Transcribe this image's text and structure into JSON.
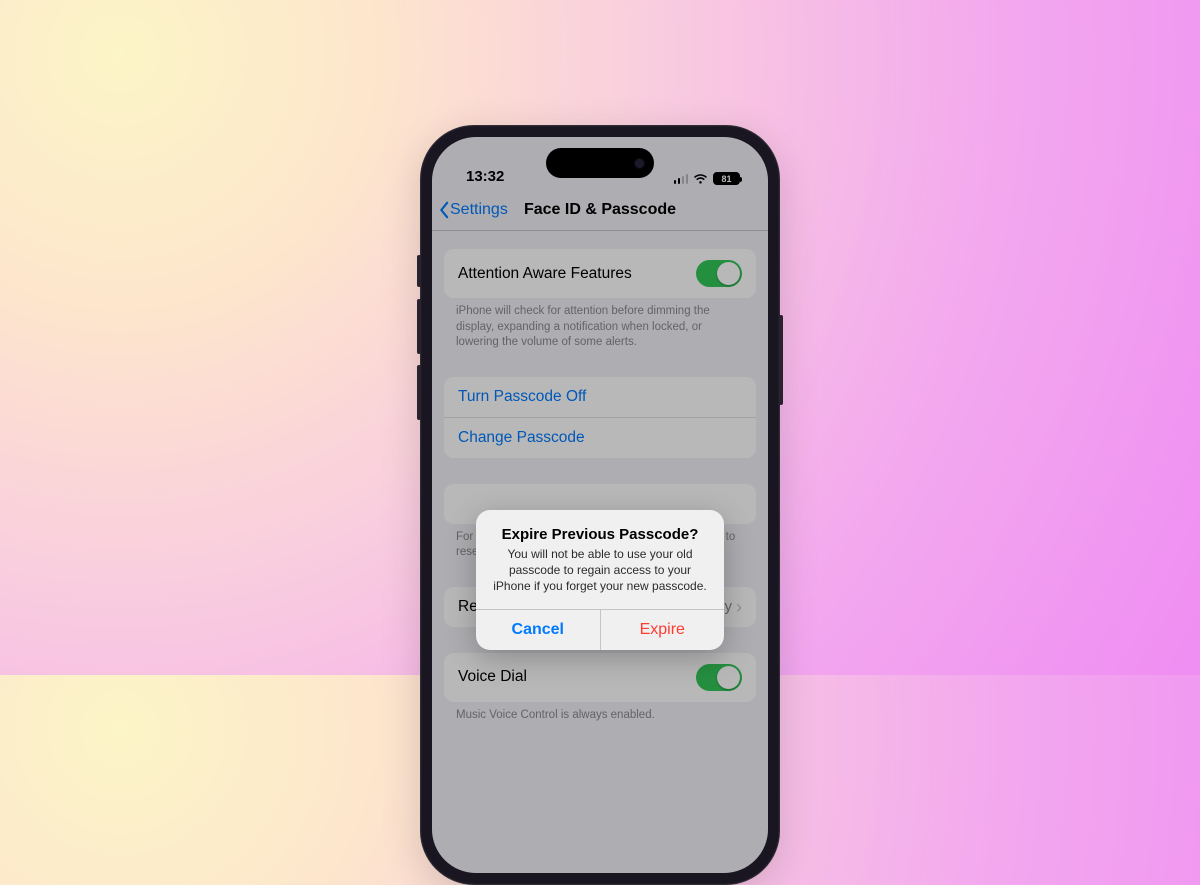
{
  "status": {
    "time": "13:32",
    "battery": "81"
  },
  "nav": {
    "back": "Settings",
    "title": "Face ID & Passcode"
  },
  "attention": {
    "label": "Attention Aware Features",
    "footer": "iPhone will check for attention before dimming the display, expanding a notification when locked, or lowering the volume of some alerts."
  },
  "passcode": {
    "turn_off": "Turn Passcode Off",
    "change": "Change Passcode"
  },
  "expire_footer_prefix": "For the n",
  "expire_footer_suffix": "sed to",
  "expire_footer_line2": "reset yo",
  "require": {
    "label_visible": "Req",
    "value_visible": "ly"
  },
  "voice": {
    "label": "Voice Dial",
    "footer": "Music Voice Control is always enabled."
  },
  "alert": {
    "title": "Expire Previous Passcode?",
    "message": "You will not be able to use your old passcode to regain access to your iPhone if you forget your new passcode.",
    "cancel": "Cancel",
    "confirm": "Expire"
  }
}
